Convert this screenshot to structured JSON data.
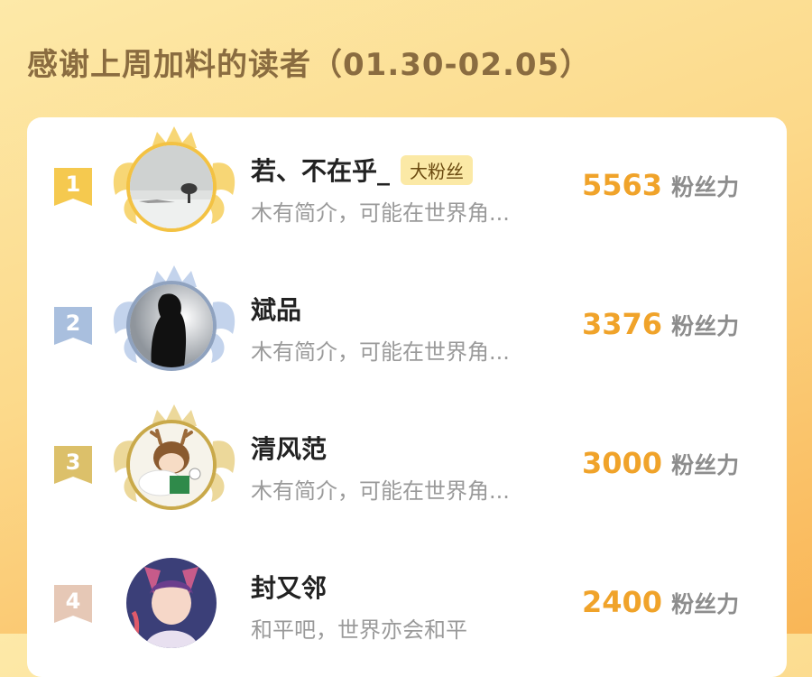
{
  "header": {
    "title": "感谢上周加料的读者（01.30-02.05）"
  },
  "readers": [
    {
      "rank": "1",
      "name": "若、不在乎_",
      "tag": "大粉丝",
      "bio": "木有简介，可能在世界角...",
      "score": "5563",
      "score_unit": "粉丝力",
      "badge_color": "#f5c94f",
      "wing_color": "#f7d675",
      "ring_color": "#f3c243",
      "avatar_icon": "snow-tree-avatar-icon"
    },
    {
      "rank": "2",
      "name": "斌品",
      "tag": "",
      "bio": "木有简介，可能在世界角...",
      "score": "3376",
      "score_unit": "粉丝力",
      "badge_color": "#a9bfde",
      "wing_color": "#c3d3ec",
      "ring_color": "#8fa2bf",
      "avatar_icon": "silhouette-avatar-icon"
    },
    {
      "rank": "3",
      "name": "清风范",
      "tag": "",
      "bio": "木有简介，可能在世界角...",
      "score": "3000",
      "score_unit": "粉丝力",
      "badge_color": "#dcc06a",
      "wing_color": "#ecd89a",
      "ring_color": "#c9a94a",
      "avatar_icon": "anime-deer-avatar-icon"
    },
    {
      "rank": "4",
      "name": "封又邻",
      "tag": "",
      "bio": "和平吧，世界亦会和平",
      "score": "2400",
      "score_unit": "粉丝力",
      "badge_color": "#e6c8b6",
      "wing_color": "",
      "ring_color": "",
      "avatar_icon": "anime-girl-avatar-icon"
    }
  ]
}
